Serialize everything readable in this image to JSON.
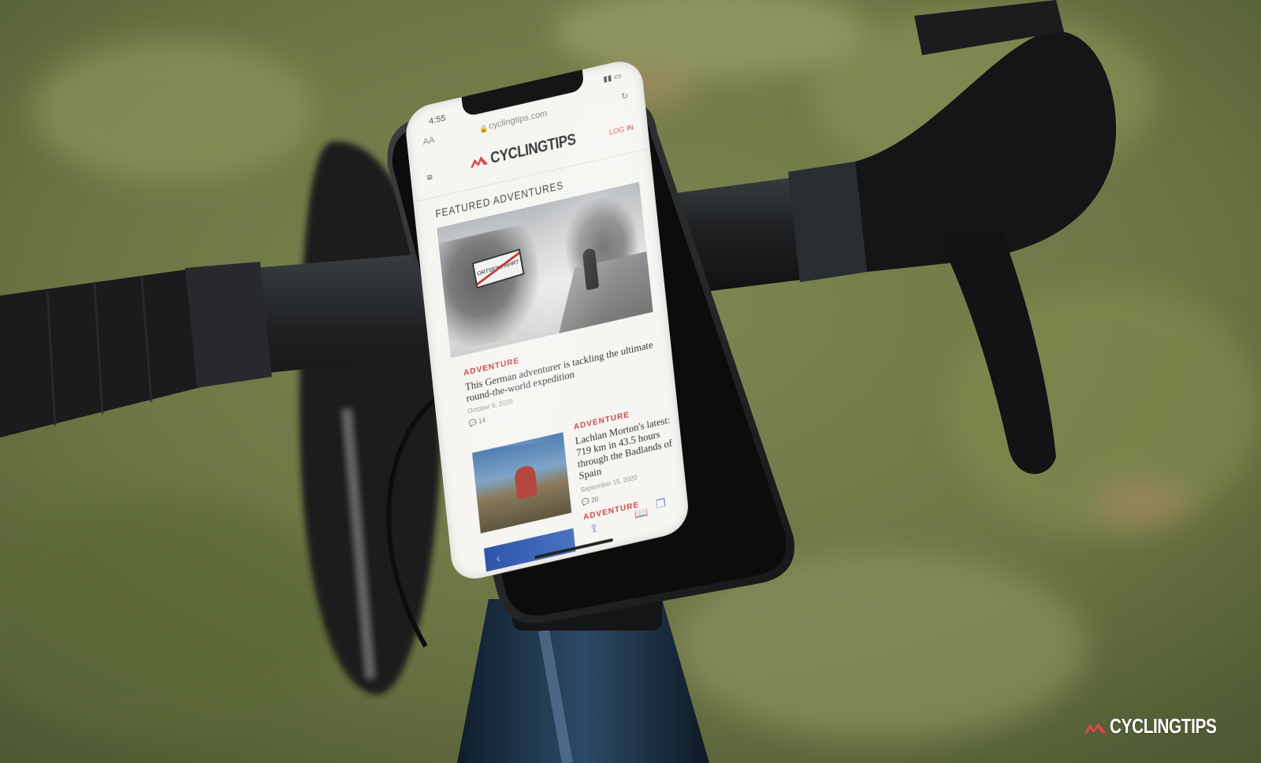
{
  "photo": {
    "subject": "smartphone mounted on bicycle handlebar",
    "background_color": "#6f7a47",
    "handlebar_color": "#222426",
    "accent_red": "#d24b4b"
  },
  "phone_ui": {
    "status": {
      "time": "4:55"
    },
    "url_bar": {
      "aa": "AA",
      "url": "cyclingtips.com"
    },
    "site": {
      "menu_icon": "hamburger-icon",
      "logo_text": "CYCLINGTIPS",
      "login": "LOG IN"
    },
    "section_title": "FEATURED ADVENTURES",
    "hero": {
      "sign_text": "ORTSEINFAHRT"
    },
    "articles": [
      {
        "tag": "ADVENTURE",
        "headline": "This German adventurer is tackling the ultimate round-the-world expedition",
        "date": "October 6, 2020",
        "comments": "14"
      },
      {
        "tag": "ADVENTURE",
        "headline": "Lachlan Morton's latest: 719 km in 43.5 hours through the Badlands of Spain",
        "date": "September 15, 2020",
        "comments": "20"
      },
      {
        "tag": "ADVENTURE"
      }
    ],
    "toolbar": {
      "back_icon": "chevron-left-icon",
      "share_icon": "share-icon",
      "bookmarks_icon": "book-icon",
      "tabs_icon": "tabs-icon"
    }
  },
  "watermark": {
    "text": "CYCLINGTIPS"
  }
}
